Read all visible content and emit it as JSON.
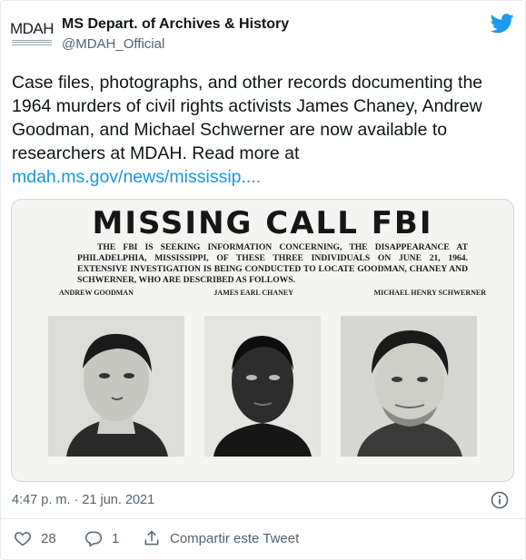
{
  "account": {
    "display_name": "MS Depart. of Archives & History",
    "handle": "@MDAH_Official",
    "avatar_text": "MDAH"
  },
  "tweet": {
    "text": "Case files, photographs, and other records documenting the 1964 murders of civil rights activists James Chaney, Andrew Goodman, and Michael Schwerner are now available to researchers at MDAH. Read more at",
    "link": "mdah.ms.gov/news/mississip...."
  },
  "media": {
    "poster_title": "MISSING CALL FBI",
    "poster_body": "THE FBI IS SEEKING INFORMATION CONCERNING, THE DISAPPEARANCE AT PHILADELPHIA, MISSISSIPPI, OF THESE THREE INDIVIDUALS ON JUNE 21, 1964. EXTENSIVE INVESTIGATION IS BEING CONDUCTED TO LOCATE GOODMAN, CHANEY AND SCHWERNER, WHO ARE DESCRIBED AS FOLLOWS.",
    "names": [
      "ANDREW GOODMAN",
      "JAMES EARL CHANEY",
      "MICHAEL HENRY SCHWERNER"
    ]
  },
  "meta": {
    "timestamp": "4:47 p. m. · 21 jun. 2021"
  },
  "actions": {
    "likes": "28",
    "replies": "1",
    "share_label": "Compartir este Tweet"
  },
  "colors": {
    "link": "#1b95e0",
    "twitter_blue": "#1d9bf0",
    "secondary_text": "#536471"
  },
  "icons": [
    "twitter-bird-icon",
    "info-icon",
    "heart-icon",
    "reply-icon",
    "share-icon"
  ]
}
